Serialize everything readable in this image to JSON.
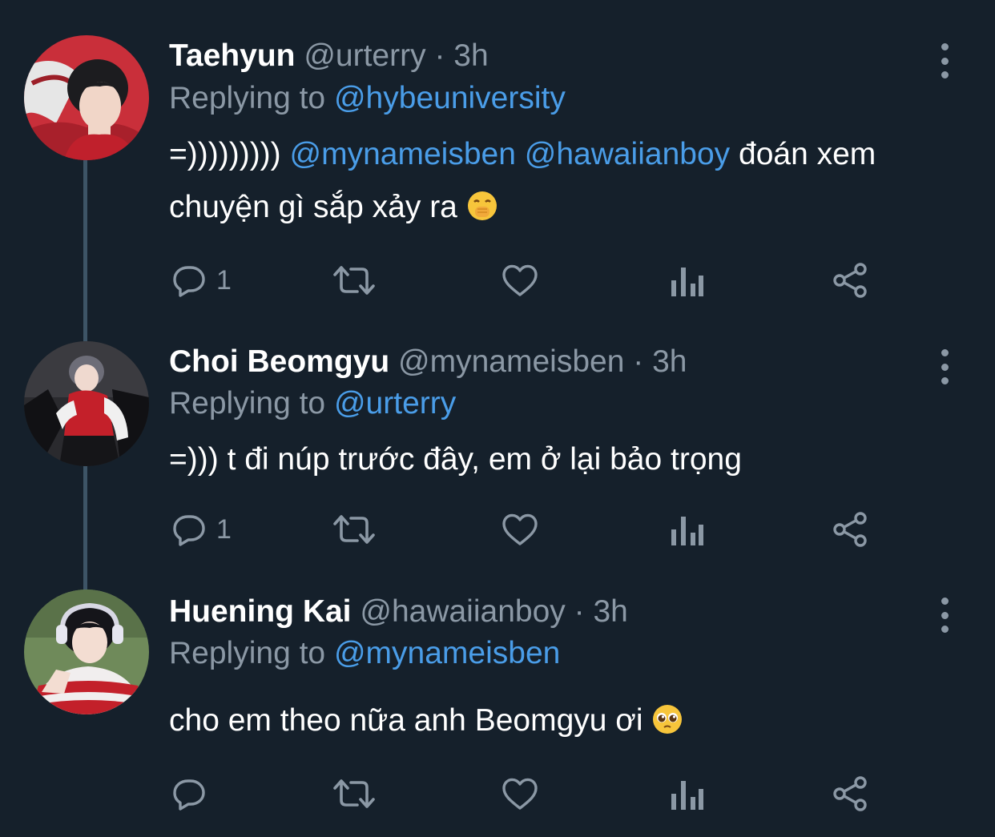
{
  "tweets": [
    {
      "name": "Taehyun",
      "handle": "@urterry",
      "separator": "·",
      "time": "3h",
      "replying_prefix": "Replying to",
      "replying_to": "@hybeuniversity",
      "text_start": "=)))))))))",
      "mention_1": "@mynameisben",
      "mention_2": "@hawaiianboy",
      "text_end": "đoán xem chuyện gì sắp xảy ra",
      "emoji": "face-with-hand-over-mouth",
      "reply_count": "1"
    },
    {
      "name": "Choi Beomgyu",
      "handle": "@mynameisben",
      "separator": "·",
      "time": "3h",
      "replying_prefix": "Replying to",
      "replying_to": "@urterry",
      "text": "=))) t đi núp trước đây, em ở lại bảo trọng",
      "reply_count": "1"
    },
    {
      "name": "Huening Kai",
      "handle": "@hawaiianboy",
      "separator": "·",
      "time": "3h",
      "replying_prefix": "Replying to",
      "replying_to": "@mynameisben",
      "text": "cho em theo nữa anh Beomgyu ơi",
      "emoji": "pleading-face",
      "reply_count": ""
    }
  ],
  "icons": {
    "reply": "reply-icon",
    "retweet": "retweet-icon",
    "like": "like-icon",
    "analytics": "analytics-icon",
    "share": "share-icon",
    "more": "more-options-icon"
  },
  "colors": {
    "background": "#15202b",
    "text": "#ffffff",
    "secondary": "#8b98a5",
    "link": "#4a9de8"
  }
}
